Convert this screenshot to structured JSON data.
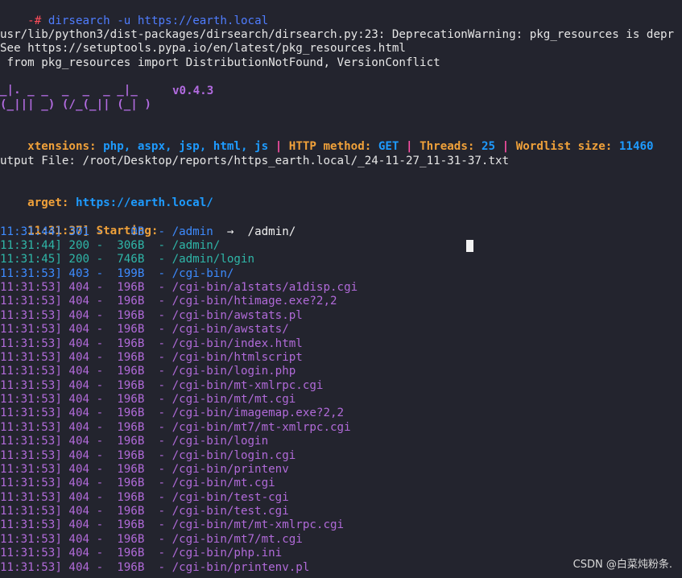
{
  "terminal": {
    "prompt_symbol": "-#",
    "command": "dirsearch",
    "command_args": "-u https://earth.local",
    "warning_lines": [
      "usr/lib/python3/dist-packages/dirsearch/dirsearch.py:23: DeprecationWarning: pkg_resources is depr",
      "See https://setuptools.pypa.io/en/latest/pkg_resources.html",
      " from pkg_resources import DistributionNotFound, VersionConflict"
    ],
    "banner_top": "_|. _ _  _  _  _ _|_",
    "banner_bottom": "(_||| _) (/_(_|| (_| )",
    "version": "v0.4.3",
    "config": {
      "ext_label": "xtensions:",
      "ext_value": "php, aspx, jsp, html, js",
      "sep": "|",
      "method_label": "HTTP method:",
      "method_value": "GET",
      "threads_label": "Threads:",
      "threads_value": "25",
      "wordlist_label": "Wordlist size:",
      "wordlist_value": "11460"
    },
    "output_line": "utput File: /root/Desktop/reports/https_earth.local/_24-11-27_11-31-37.txt",
    "target_label": "arget:",
    "target_value": "https://earth.local/",
    "starting_time": "11:31:37]",
    "starting_label": "Starting:",
    "results": [
      {
        "time": "11:31:44]",
        "status": "301",
        "size": "   0B",
        "path": "/admin",
        "redirect": "/admin/",
        "cls": "blue"
      },
      {
        "time": "11:31:44]",
        "status": "200",
        "size": " 306B",
        "path": "/admin/",
        "cls": "teal"
      },
      {
        "time": "11:31:45]",
        "status": "200",
        "size": " 746B",
        "path": "/admin/login",
        "cls": "teal"
      },
      {
        "time": "11:31:53]",
        "status": "403",
        "size": " 199B",
        "path": "/cgi-bin/",
        "cls": "blue"
      },
      {
        "time": "11:31:53]",
        "status": "404",
        "size": " 196B",
        "path": "/cgi-bin/a1stats/a1disp.cgi",
        "cls": "c404"
      },
      {
        "time": "11:31:53]",
        "status": "404",
        "size": " 196B",
        "path": "/cgi-bin/htimage.exe?2,2",
        "cls": "c404"
      },
      {
        "time": "11:31:53]",
        "status": "404",
        "size": " 196B",
        "path": "/cgi-bin/awstats.pl",
        "cls": "c404"
      },
      {
        "time": "11:31:53]",
        "status": "404",
        "size": " 196B",
        "path": "/cgi-bin/awstats/",
        "cls": "c404"
      },
      {
        "time": "11:31:53]",
        "status": "404",
        "size": " 196B",
        "path": "/cgi-bin/index.html",
        "cls": "c404"
      },
      {
        "time": "11:31:53]",
        "status": "404",
        "size": " 196B",
        "path": "/cgi-bin/htmlscript",
        "cls": "c404"
      },
      {
        "time": "11:31:53]",
        "status": "404",
        "size": " 196B",
        "path": "/cgi-bin/login.php",
        "cls": "c404"
      },
      {
        "time": "11:31:53]",
        "status": "404",
        "size": " 196B",
        "path": "/cgi-bin/mt-xmlrpc.cgi",
        "cls": "c404"
      },
      {
        "time": "11:31:53]",
        "status": "404",
        "size": " 196B",
        "path": "/cgi-bin/mt/mt.cgi",
        "cls": "c404"
      },
      {
        "time": "11:31:53]",
        "status": "404",
        "size": " 196B",
        "path": "/cgi-bin/imagemap.exe?2,2",
        "cls": "c404"
      },
      {
        "time": "11:31:53]",
        "status": "404",
        "size": " 196B",
        "path": "/cgi-bin/mt7/mt-xmlrpc.cgi",
        "cls": "c404"
      },
      {
        "time": "11:31:53]",
        "status": "404",
        "size": " 196B",
        "path": "/cgi-bin/login",
        "cls": "c404"
      },
      {
        "time": "11:31:53]",
        "status": "404",
        "size": " 196B",
        "path": "/cgi-bin/login.cgi",
        "cls": "c404"
      },
      {
        "time": "11:31:53]",
        "status": "404",
        "size": " 196B",
        "path": "/cgi-bin/printenv",
        "cls": "c404"
      },
      {
        "time": "11:31:53]",
        "status": "404",
        "size": " 196B",
        "path": "/cgi-bin/mt.cgi",
        "cls": "c404"
      },
      {
        "time": "11:31:53]",
        "status": "404",
        "size": " 196B",
        "path": "/cgi-bin/test-cgi",
        "cls": "c404"
      },
      {
        "time": "11:31:53]",
        "status": "404",
        "size": " 196B",
        "path": "/cgi-bin/test.cgi",
        "cls": "c404"
      },
      {
        "time": "11:31:53]",
        "status": "404",
        "size": " 196B",
        "path": "/cgi-bin/mt/mt-xmlrpc.cgi",
        "cls": "c404"
      },
      {
        "time": "11:31:53]",
        "status": "404",
        "size": " 196B",
        "path": "/cgi-bin/mt7/mt.cgi",
        "cls": "c404"
      },
      {
        "time": "11:31:53]",
        "status": "404",
        "size": " 196B",
        "path": "/cgi-bin/php.ini",
        "cls": "c404"
      },
      {
        "time": "11:31:53]",
        "status": "404",
        "size": " 196B",
        "path": "/cgi-bin/printenv.pl",
        "cls": "c404"
      }
    ]
  },
  "watermark": "CSDN @白菜炖粉条."
}
